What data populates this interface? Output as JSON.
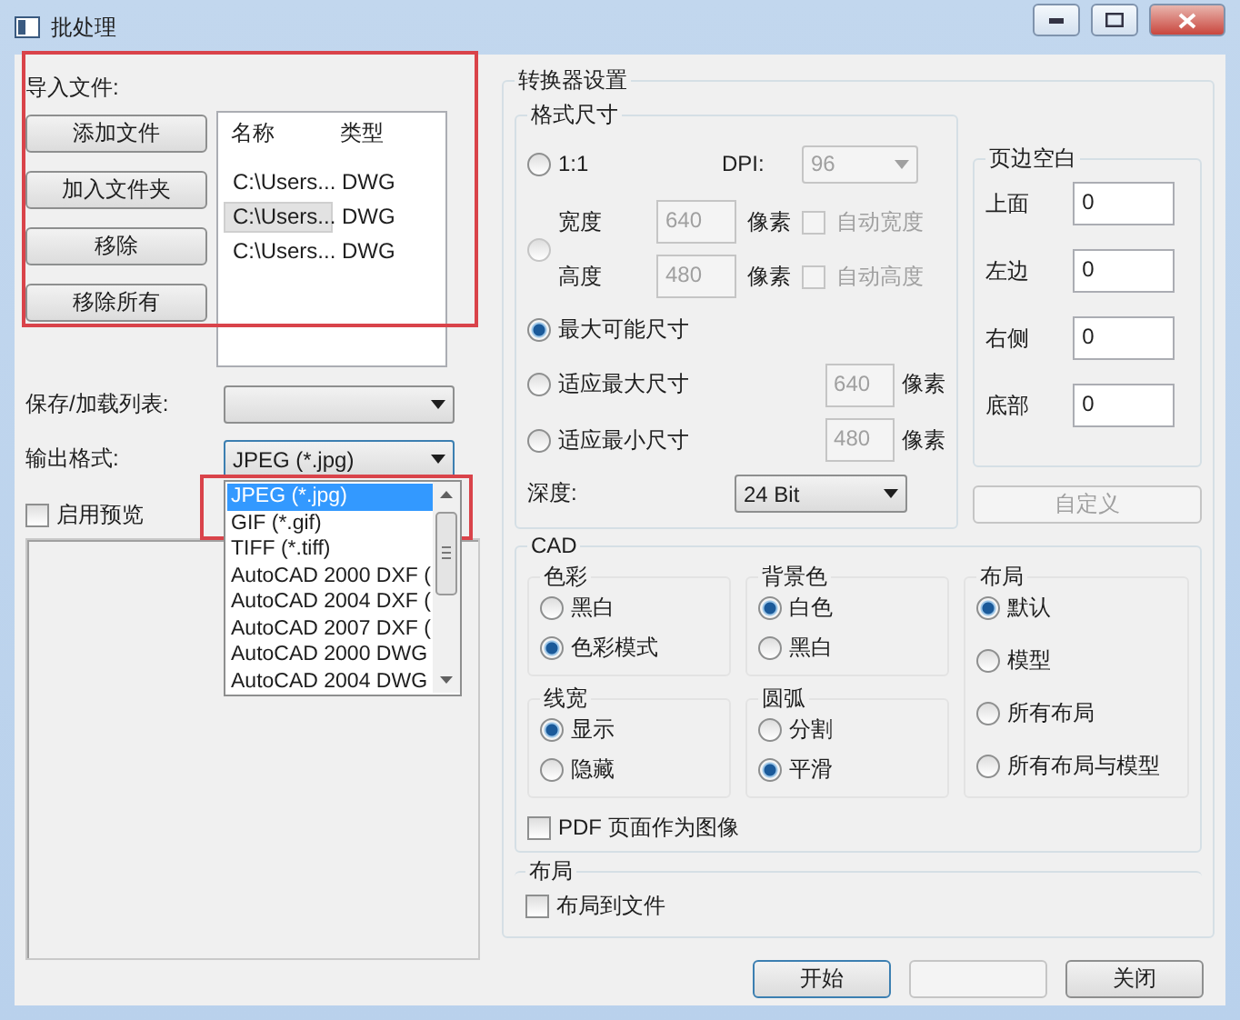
{
  "window": {
    "title": "批处理"
  },
  "import": {
    "label": "导入文件:",
    "highlighted": true,
    "buttons": [
      "添加文件",
      "加入文件夹",
      "移除",
      "移除所有"
    ],
    "columns": [
      "名称",
      "类型"
    ],
    "files": [
      {
        "name": "C:\\Users...",
        "type": "DWG",
        "selected": false
      },
      {
        "name": "C:\\Users...",
        "type": "DWG",
        "selected": true
      },
      {
        "name": "C:\\Users...",
        "type": "DWG",
        "selected": false
      }
    ]
  },
  "save_list": {
    "label": "保存/加载列表:"
  },
  "output_format": {
    "label": "输出格式:",
    "value": "JPEG (*.jpg)",
    "highlighted": true,
    "options": [
      {
        "label": "JPEG (*.jpg)",
        "selected": true
      },
      {
        "label": "GIF (*.gif)",
        "selected": false
      },
      {
        "label": "TIFF (*.tiff)",
        "selected": false
      },
      {
        "label": "AutoCAD 2000 DXF (",
        "selected": false
      },
      {
        "label": "AutoCAD 2004 DXF (",
        "selected": false
      },
      {
        "label": "AutoCAD 2007 DXF (",
        "selected": false
      },
      {
        "label": "AutoCAD 2000 DWG",
        "selected": false
      },
      {
        "label": "AutoCAD 2004 DWG",
        "selected": false
      }
    ]
  },
  "preview": {
    "label": "启用预览",
    "checked": false
  },
  "converter": {
    "title": "转换器设置",
    "size": {
      "title": "格式尺寸",
      "options": [
        {
          "kind": "ratio",
          "label": "1:1",
          "selected": false,
          "dpi_label": "DPI:",
          "dpi": "96"
        },
        {
          "kind": "custom",
          "selected": false,
          "fields": [
            {
              "label": "宽度",
              "value": "640",
              "unit": "像素",
              "auto": "自动宽度",
              "checked": false
            },
            {
              "label": "高度",
              "value": "480",
              "unit": "像素",
              "auto": "自动高度",
              "checked": false
            }
          ]
        },
        {
          "kind": "plain",
          "label": "最大可能尺寸",
          "selected": true
        },
        {
          "kind": "fit",
          "label": "适应最大尺寸",
          "selected": false,
          "value": "640",
          "unit": "像素"
        },
        {
          "kind": "fit",
          "label": "适应最小尺寸",
          "selected": false,
          "value": "480",
          "unit": "像素"
        }
      ],
      "depth_label": "深度:",
      "depth": "24 Bit"
    },
    "margins": {
      "title": "页边空白",
      "fields": [
        {
          "label": "上面",
          "value": "0"
        },
        {
          "label": "左边",
          "value": "0"
        },
        {
          "label": "右侧",
          "value": "0"
        },
        {
          "label": "底部",
          "value": "0"
        }
      ],
      "button": "自定义"
    },
    "cad": {
      "title": "CAD",
      "columns": [
        [
          {
            "title": "色彩",
            "options": [
              {
                "label": "黑白",
                "selected": false
              },
              {
                "label": "色彩模式",
                "selected": true
              }
            ]
          },
          {
            "title": "线宽",
            "options": [
              {
                "label": "显示",
                "selected": true
              },
              {
                "label": "隐藏",
                "selected": false
              }
            ]
          }
        ],
        [
          {
            "title": "背景色",
            "options": [
              {
                "label": "白色",
                "selected": true
              },
              {
                "label": "黑白",
                "selected": false
              }
            ]
          },
          {
            "title": "圆弧",
            "options": [
              {
                "label": "分割",
                "selected": false
              },
              {
                "label": "平滑",
                "selected": true
              }
            ]
          }
        ],
        [
          {
            "title": "布局",
            "options": [
              {
                "label": "默认",
                "selected": true
              },
              {
                "label": "模型",
                "selected": false
              },
              {
                "label": "所有布局",
                "selected": false
              },
              {
                "label": "所有布局与模型",
                "selected": false
              }
            ]
          }
        ]
      ],
      "pdf": {
        "label": "PDF 页面作为图像",
        "checked": false
      }
    },
    "layout": {
      "title": "布局",
      "checkbox": {
        "label": "布局到文件",
        "checked": false
      }
    }
  },
  "footer": [
    {
      "label": "开始",
      "default": true,
      "disabled": false
    },
    {
      "default": false,
      "disabled": true
    },
    {
      "label": "关闭",
      "default": false,
      "disabled": false
    }
  ]
}
